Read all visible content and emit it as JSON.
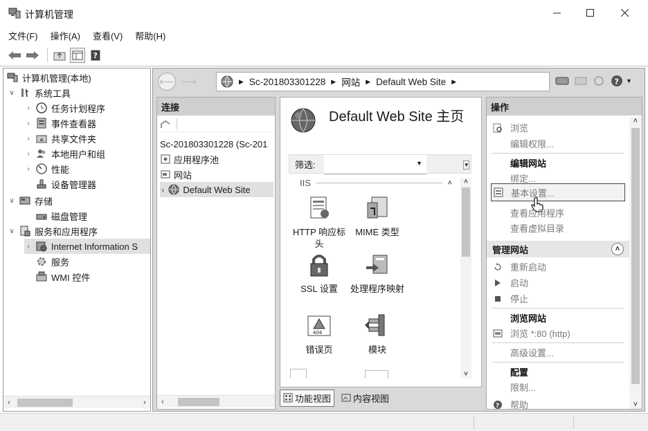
{
  "window": {
    "title": "计算机管理",
    "controls": [
      "minimize",
      "maximize",
      "close"
    ]
  },
  "menubar": [
    "文件(F)",
    "操作(A)",
    "查看(V)",
    "帮助(H)"
  ],
  "toolbar": {
    "icons": [
      "back-icon",
      "forward-icon",
      "up-folder-icon",
      "show-hide-tree-icon",
      "help-icon"
    ]
  },
  "tree": {
    "root": "计算机管理(本地)",
    "items": [
      {
        "label": "系统工具",
        "level": 1,
        "expanded": true,
        "icon": "tools-icon"
      },
      {
        "label": "任务计划程序",
        "level": 2,
        "icon": "clock-icon"
      },
      {
        "label": "事件查看器",
        "level": 2,
        "icon": "event-viewer-icon"
      },
      {
        "label": "共享文件夹",
        "level": 2,
        "icon": "shared-folder-icon"
      },
      {
        "label": "本地用户和组",
        "level": 2,
        "icon": "users-icon"
      },
      {
        "label": "性能",
        "level": 2,
        "icon": "performance-icon"
      },
      {
        "label": "设备管理器",
        "level": 2,
        "icon": "device-manager-icon"
      },
      {
        "label": "存储",
        "level": 1,
        "expanded": true,
        "icon": "storage-icon"
      },
      {
        "label": "磁盘管理",
        "level": 2,
        "icon": "disk-icon"
      },
      {
        "label": "服务和应用程序",
        "level": 1,
        "expanded": true,
        "icon": "services-apps-icon"
      },
      {
        "label": "Internet Information S",
        "level": 2,
        "selected": true,
        "icon": "iis-icon"
      },
      {
        "label": "服务",
        "level": 2,
        "icon": "services-icon"
      },
      {
        "label": "WMI 控件",
        "level": 2,
        "icon": "wmi-icon"
      }
    ]
  },
  "address": {
    "crumbs": [
      "Sc-201803301228",
      "网站",
      "Default Web Site"
    ],
    "right_icons": [
      "connect-icon",
      "stop-icon",
      "refresh-icon",
      "help-icon"
    ]
  },
  "connections": {
    "header": "连接",
    "items": [
      {
        "label": "Sc-201803301228 (Sc-201",
        "icon": ""
      },
      {
        "label": "应用程序池",
        "icon": "app-pool-icon"
      },
      {
        "label": "网站",
        "icon": "sites-icon"
      },
      {
        "label": "Default Web Site",
        "icon": "globe-icon",
        "selected": true
      }
    ]
  },
  "center": {
    "title": "Default Web Site 主页",
    "filter_label": "筛选:",
    "group": "IIS",
    "features": [
      {
        "label": "HTTP 响应标头",
        "icon": "http-headers-icon"
      },
      {
        "label": "MIME 类型",
        "icon": "mime-types-icon"
      },
      {
        "label": "SSL 设置",
        "icon": "lock-icon"
      },
      {
        "label": "处理程序映射",
        "icon": "handler-mappings-icon"
      },
      {
        "label": "错误页",
        "icon": "error-pages-icon"
      },
      {
        "label": "模块",
        "icon": "modules-icon"
      }
    ],
    "views": [
      "功能视图",
      "内容视图"
    ]
  },
  "actions": {
    "header": "操作",
    "items": [
      {
        "label": "浏览",
        "dim": true,
        "icon": "browse-icon"
      },
      {
        "label": "编辑权限...",
        "dim": true,
        "icon": ""
      },
      {
        "label": "编辑网站",
        "bold": true,
        "icon": ""
      },
      {
        "label": "绑定...",
        "dim": true,
        "icon": ""
      },
      {
        "label": "基本设置...",
        "dim": true,
        "icon": "settings-icon",
        "hover": true
      },
      {
        "label": "查看应用程序",
        "dim": true,
        "icon": ""
      },
      {
        "label": "查看虚拟目录",
        "dim": true,
        "icon": ""
      }
    ],
    "manage_header": "管理网站",
    "manage_items": [
      {
        "label": "重新启动",
        "dim": true,
        "icon": "restart-icon"
      },
      {
        "label": "启动",
        "dim": true,
        "icon": "start-icon"
      },
      {
        "label": "停止",
        "dim": true,
        "icon": "stop-icon"
      },
      {
        "label": "浏览网站",
        "bold": true,
        "icon": ""
      },
      {
        "label": "浏览 *:80 (http)",
        "dim": true,
        "icon": "browse-icon"
      },
      {
        "label": "高级设置...",
        "dim": true,
        "icon": ""
      },
      {
        "label": "配置",
        "bold": true,
        "icon": ""
      },
      {
        "label": "限制...",
        "dim": true,
        "icon": ""
      },
      {
        "label": "帮助",
        "dim": true,
        "icon": "help-icon"
      }
    ]
  }
}
